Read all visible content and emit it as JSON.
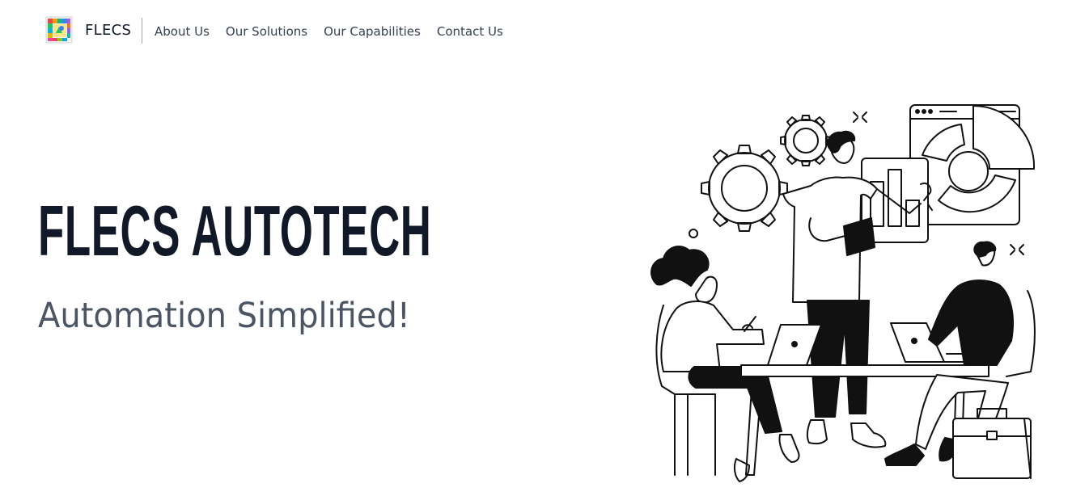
{
  "header": {
    "brand_name": "FLECS",
    "logo_icon": "flecs-logo-icon",
    "nav_items": [
      {
        "label": "About Us"
      },
      {
        "label": "Our Solutions"
      },
      {
        "label": "Our Capabilities"
      },
      {
        "label": "Contact Us"
      }
    ]
  },
  "hero": {
    "title": "FLECS AUTOTECH",
    "subtitle": "Automation Simplified!",
    "illustration_icon": "team-collaboration-illustration"
  },
  "colors": {
    "text_dark": "#111827",
    "text_muted": "#4b5563",
    "background": "#ffffff"
  }
}
